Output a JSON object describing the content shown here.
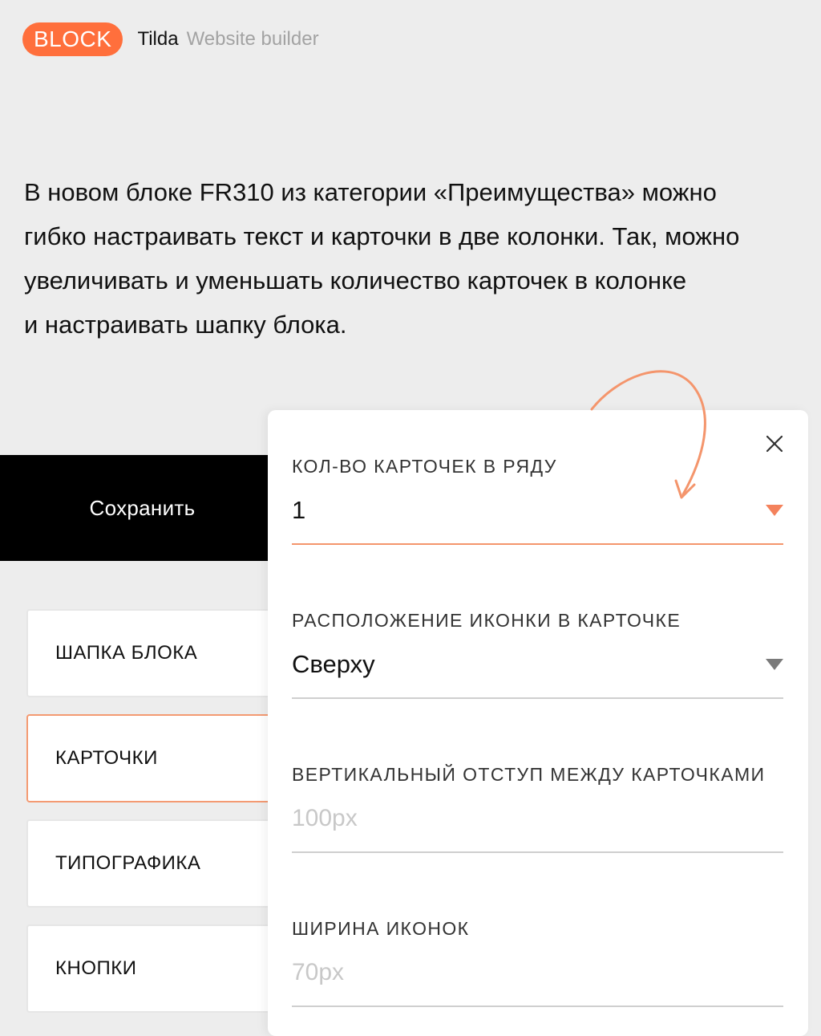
{
  "header": {
    "badge": "BLOCK",
    "brand": "Tilda",
    "tagline": "Website builder"
  },
  "description": "В новом блоке FR310 из категории «Преимущества» можно\nгибко настраивать текст и карточки в две колонки. Так, можно\nувеличивать и уменьшать количество карточек в колонке\nи настраивать шапку блока.",
  "save_button": "Сохранить",
  "sidebar": {
    "items": [
      {
        "label": "ШАПКА БЛОКА"
      },
      {
        "label": "КАРТОЧКИ"
      },
      {
        "label": "ТИПОГРАФИКА"
      },
      {
        "label": "КНОПКИ"
      }
    ]
  },
  "panel": {
    "fields": [
      {
        "label": "КОЛ-ВО КАРТОЧЕК В РЯДУ",
        "value": "1"
      },
      {
        "label": "РАСПОЛОЖЕНИЕ ИКОНКИ В КАРТОЧКЕ",
        "value": "Сверху"
      },
      {
        "label": "ВЕРТИКАЛЬНЫЙ ОТСТУП МЕЖДУ КАРТОЧКАМИ",
        "placeholder": "100px"
      },
      {
        "label": "ШИРИНА ИКОНОК",
        "placeholder": "70px"
      }
    ]
  },
  "icons": {
    "close": "close-icon",
    "dropdown": "chevron-down-icon",
    "annotation": "curved-arrow-icon"
  },
  "colors": {
    "accent": "#ff6f3c",
    "field_focus": "#f4956c",
    "arrow": "#f4956c",
    "background": "#ededed"
  }
}
